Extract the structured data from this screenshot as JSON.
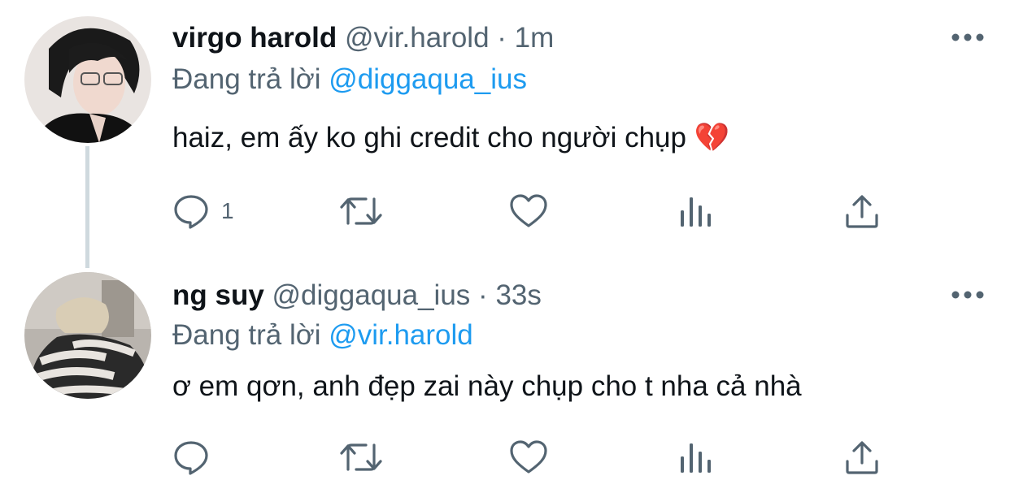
{
  "tweets": [
    {
      "display_name": "virgo harold",
      "handle": "@vir.harold",
      "separator": "·",
      "time": "1m",
      "replying_prefix": "Đang trả lời",
      "replying_to": "@diggaqua_ius",
      "text": "haiz, em ấy ko ghi credit cho người chụp",
      "emoji": "💔",
      "reply_count": "1",
      "avatar_icon": "avatar-photo",
      "more_icon": "more-horizontal-icon"
    },
    {
      "display_name": "ng suy",
      "handle": "@diggaqua_ius",
      "separator": "·",
      "time": "33s",
      "replying_prefix": "Đang trả lời",
      "replying_to": "@vir.harold",
      "text": "ơ em qơn, anh đẹp zai này chụp cho t nha cả nhà",
      "reply_count": "",
      "avatar_icon": "avatar-photo",
      "more_icon": "more-horizontal-icon"
    }
  ],
  "colors": {
    "text": "#0f1419",
    "secondary": "#536471",
    "link": "#1d9bf0",
    "thread_line": "#cfd9de"
  },
  "action_icons": [
    "reply-icon",
    "retweet-icon",
    "like-icon",
    "analytics-icon",
    "share-icon"
  ]
}
